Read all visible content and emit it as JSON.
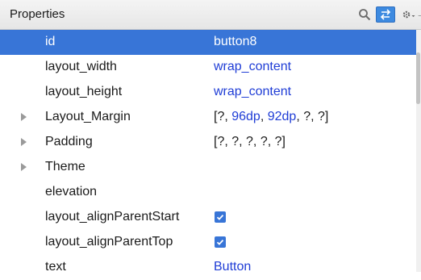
{
  "header": {
    "title": "Properties",
    "icons": [
      "search-icon",
      "swap-icon",
      "gear-icon",
      "chevron-down-icon",
      "expand-icon"
    ]
  },
  "properties": [
    {
      "name": "id",
      "value": "button8",
      "selected": true
    },
    {
      "name": "layout_width",
      "value": "wrap_content"
    },
    {
      "name": "layout_height",
      "value": "wrap_content"
    },
    {
      "name": "Layout_Margin",
      "expandable": true,
      "value_parts": [
        "[?, ",
        "96dp",
        ", ",
        "92dp",
        ", ?, ?]"
      ]
    },
    {
      "name": "Padding",
      "expandable": true,
      "value": "[?, ?, ?, ?, ?]"
    },
    {
      "name": "Theme",
      "expandable": true,
      "value": ""
    },
    {
      "name": "elevation",
      "value": ""
    },
    {
      "name": "layout_alignParentStart",
      "checked": true
    },
    {
      "name": "layout_alignParentTop",
      "checked": true
    },
    {
      "name": "text",
      "value": "Button"
    }
  ],
  "colors": {
    "selection": "#3875d7",
    "value_link": "#1f3dd6",
    "accent": "#3d8ae0"
  }
}
